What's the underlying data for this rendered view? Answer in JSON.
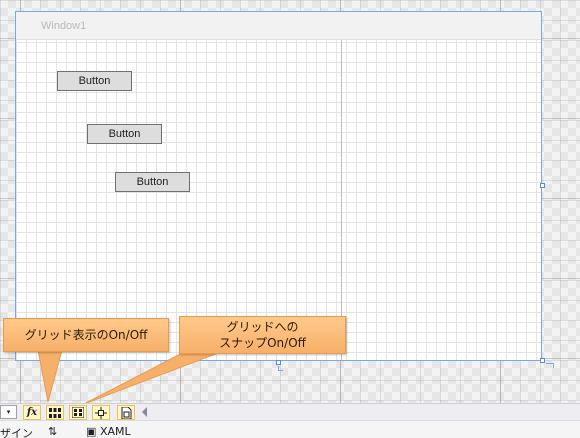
{
  "designer": {
    "window_title": "Window1",
    "buttons": [
      {
        "label": "Button"
      },
      {
        "label": "Button"
      },
      {
        "label": "Button"
      }
    ]
  },
  "callouts": {
    "grid_display": "グリッド表示のOn/Off",
    "grid_snap_line1": "グリッドへの",
    "grid_snap_line2": "スナップOn/Off"
  },
  "toolbar": {
    "zoom_arrow": "▾",
    "fx_label": "fx",
    "icons": [
      "formula-fx-icon",
      "show-grid-icon",
      "snap-to-grid-icon",
      "snap-to-snaplines-icon",
      "project-code-icon"
    ]
  },
  "tabs": {
    "design_fragment": "ザイン",
    "swap": "⇅",
    "xaml_icon": "▣",
    "xaml": "XAML"
  },
  "colors": {
    "callout_fill": "#f6b06a",
    "callout_border": "#e89b52",
    "selection_blue": "#7aa7e6",
    "toolbar_button_active": "#fff7c9"
  }
}
